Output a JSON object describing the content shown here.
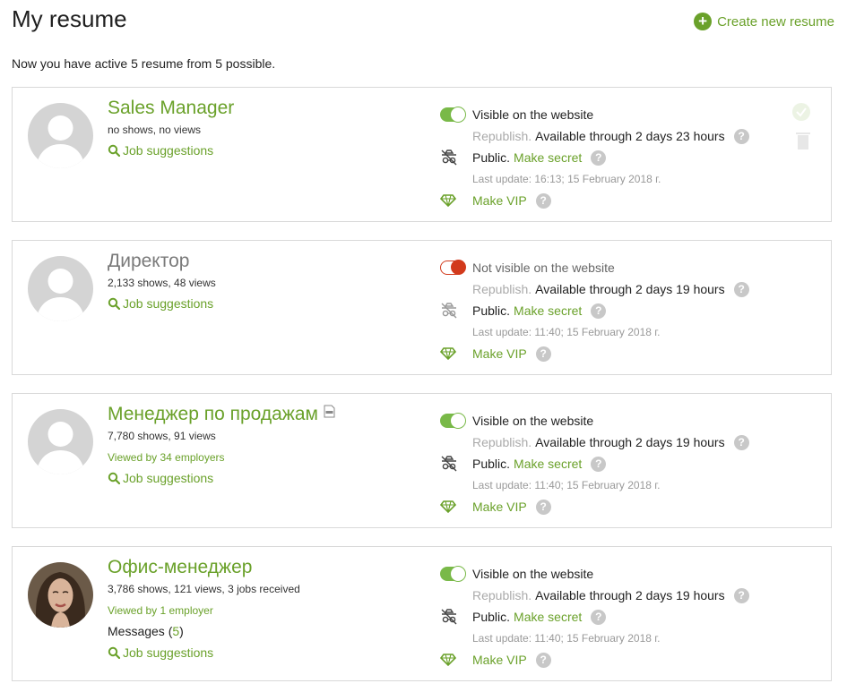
{
  "header": {
    "title": "My resume",
    "create_label": "Create new resume",
    "subtitle": "Now you have active 5 resume from 5 possible."
  },
  "labels": {
    "republish": "Republish.",
    "public": "Public.",
    "make_secret": "Make secret",
    "make_vip": "Make VIP",
    "job_suggestions": "Job suggestions",
    "messages": "Messages",
    "help": "?"
  },
  "resumes": [
    {
      "title": "Sales Manager",
      "stats": "no shows, no views",
      "visible": true,
      "visibility_text": "Visible on the website",
      "availability": "Available through 2 days 23 hours",
      "updated": "Last update: 16:13; 15 February 2018 г."
    },
    {
      "title": "Директор",
      "stats": "2,133 shows, 48 views",
      "visible": false,
      "visibility_text": "Not visible on the website",
      "availability": "Available through 2 days 19 hours",
      "updated": "Last update: 11:40; 15 February 2018 г."
    },
    {
      "title": "Менеджер по продажам",
      "stats": "7,780 shows, 91 views",
      "viewed_by": "Viewed by 34 employers",
      "visible": true,
      "visibility_text": "Visible on the website",
      "availability": "Available through 2 days 19 hours",
      "updated": "Last update: 11:40; 15 February 2018 г."
    },
    {
      "title": "Офис-менеджер",
      "stats": "3,786 shows, 121 views, 3 jobs received",
      "viewed_by": "Viewed by 1 employer",
      "messages_count": "5",
      "visible": true,
      "visibility_text": "Visible on the website",
      "availability": "Available through 2 days 19 hours",
      "updated": "Last update: 11:40; 15 February 2018 г."
    }
  ]
}
